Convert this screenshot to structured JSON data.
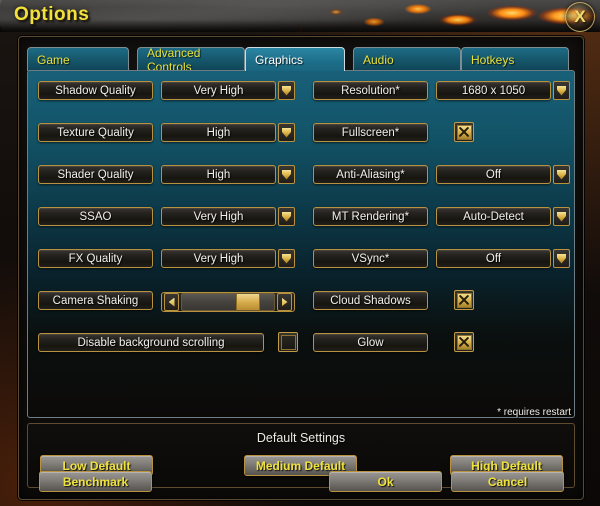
{
  "window": {
    "title": "Options",
    "close_label": "X"
  },
  "tabs": [
    {
      "label": "Game",
      "active": false
    },
    {
      "label": "Advanced Controls",
      "active": false
    },
    {
      "label": "Graphics",
      "active": true
    },
    {
      "label": "Audio",
      "active": false
    },
    {
      "label": "Hotkeys",
      "active": false
    }
  ],
  "settings": {
    "left_column": [
      {
        "label": "Shadow Quality",
        "type": "dropdown",
        "value": "Very High"
      },
      {
        "label": "Texture Quality",
        "type": "dropdown",
        "value": "High"
      },
      {
        "label": "Shader Quality",
        "type": "dropdown",
        "value": "High"
      },
      {
        "label": "SSAO",
        "type": "dropdown",
        "value": "Very High"
      },
      {
        "label": "FX Quality",
        "type": "dropdown",
        "value": "Very High"
      },
      {
        "label": "Camera Shaking",
        "type": "slider",
        "value": 83
      },
      {
        "label": "Disable background scrolling",
        "type": "checkbox",
        "checked": false
      }
    ],
    "right_column": [
      {
        "label": "Resolution*",
        "type": "dropdown",
        "value": "1680 x 1050"
      },
      {
        "label": "Fullscreen*",
        "type": "checkbox",
        "checked": true
      },
      {
        "label": "Anti-Aliasing*",
        "type": "dropdown",
        "value": "Off"
      },
      {
        "label": "MT Rendering*",
        "type": "dropdown",
        "value": "Auto-Detect"
      },
      {
        "label": "VSync*",
        "type": "dropdown",
        "value": "Off"
      },
      {
        "label": "Cloud Shadows",
        "type": "checkbox",
        "checked": true
      },
      {
        "label": "Glow",
        "type": "checkbox",
        "checked": true
      }
    ],
    "restart_note": "* requires restart"
  },
  "default_settings": {
    "title": "Default Settings",
    "buttons": [
      {
        "label": "Low Default"
      },
      {
        "label": "Medium Default"
      },
      {
        "label": "High Default"
      }
    ]
  },
  "actions": [
    {
      "label": "Benchmark"
    },
    {
      "label": "Ok"
    },
    {
      "label": "Cancel"
    }
  ],
  "colors": {
    "gold_border": "#b9923f",
    "title_yellow": "#f2e13c",
    "tab_text": "#e8e13a",
    "tab_active_text": "#ffffff",
    "panel_teal": "#186079"
  }
}
